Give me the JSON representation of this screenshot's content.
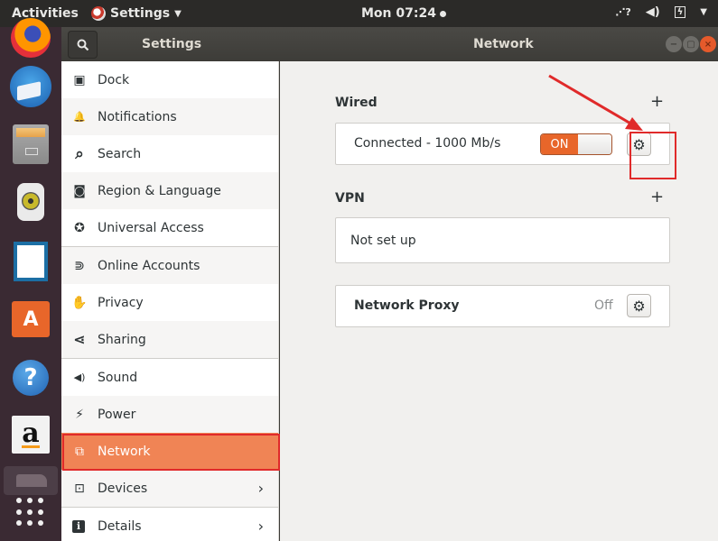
{
  "topbar": {
    "activities": "Activities",
    "app_menu": "Settings",
    "clock": "Mon 07:24",
    "tray_icons": [
      "network-unknown-icon",
      "volume-icon",
      "battery-charging-icon",
      "system-menu-caret-icon"
    ]
  },
  "dock": {
    "items": [
      "Firefox",
      "Thunderbird",
      "Files",
      "Rhythmbox",
      "LibreOffice Writer",
      "Ubuntu Software",
      "Help",
      "Amazon",
      "Running App",
      "Show Applications"
    ],
    "software_glyph": "A",
    "help_glyph": "?",
    "amazon_glyph": "a"
  },
  "header": {
    "sidebar_title": "Settings",
    "main_title": "Network",
    "search_glyph": "🔍",
    "min_glyph": "−",
    "max_glyph": "▢",
    "close_glyph": "×"
  },
  "sidebar": {
    "items": [
      {
        "label": "Dock",
        "icon": "▣"
      },
      {
        "label": "Notifications",
        "icon": "🔔"
      },
      {
        "label": "Search",
        "icon": "⌕"
      },
      {
        "label": "Region & Language",
        "icon": "◙"
      },
      {
        "label": "Universal Access",
        "icon": "✪"
      },
      {
        "label": "Online Accounts",
        "icon": "⋑"
      },
      {
        "label": "Privacy",
        "icon": "✋"
      },
      {
        "label": "Sharing",
        "icon": "⋖"
      },
      {
        "label": "Sound",
        "icon": "◀)"
      },
      {
        "label": "Power",
        "icon": "⚡"
      },
      {
        "label": "Network",
        "icon": "⧉"
      },
      {
        "label": "Devices",
        "icon": "⊡"
      },
      {
        "label": "Details",
        "icon": "ℹ"
      }
    ],
    "active": "Network",
    "chevron": "›"
  },
  "main": {
    "wired": {
      "title": "Wired",
      "add": "+",
      "status": "Connected - 1000 Mb/s",
      "toggle_label": "ON",
      "toggle_state": true,
      "gear": "⚙"
    },
    "vpn": {
      "title": "VPN",
      "add": "+",
      "status": "Not set up"
    },
    "proxy": {
      "title": "Network Proxy",
      "status": "Off",
      "gear": "⚙"
    }
  },
  "colors": {
    "accent": "#e8662a",
    "active_row": "#f08455",
    "annotation": "#e02a2a"
  }
}
